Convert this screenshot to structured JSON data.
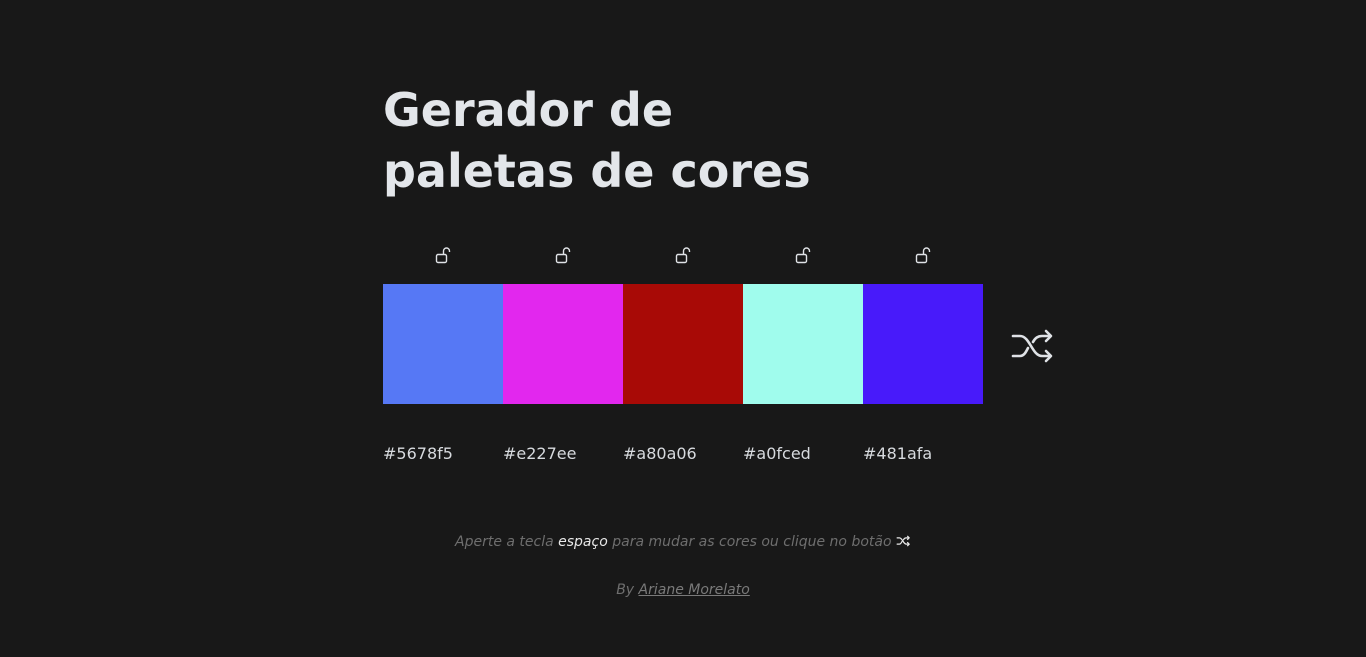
{
  "title": {
    "line1": "Gerador de",
    "line2": "paletas de cores"
  },
  "palette": [
    {
      "hex": "#5678f5",
      "color": "#5678f5",
      "locked": false
    },
    {
      "hex": "#e227ee",
      "color": "#e227ee",
      "locked": false
    },
    {
      "hex": "#a80a06",
      "color": "#a80a06",
      "locked": false
    },
    {
      "hex": "#a0fced",
      "color": "#a0fced",
      "locked": false
    },
    {
      "hex": "#481afa",
      "color": "#481afa",
      "locked": false
    }
  ],
  "icons": {
    "lock": "unlocked-padlock-icon",
    "shuffle": "shuffle-icon"
  },
  "hint": {
    "before": "Aperte a tecla",
    "key": "espaço",
    "after": "para mudar as cores ou clique no botão"
  },
  "credit": {
    "prefix": "By",
    "author": "Ariane Morelato"
  },
  "colors": {
    "background": "#181818",
    "title": "#e3e6ea",
    "text": "#d7dade",
    "muted": "#6e6e6e"
  }
}
